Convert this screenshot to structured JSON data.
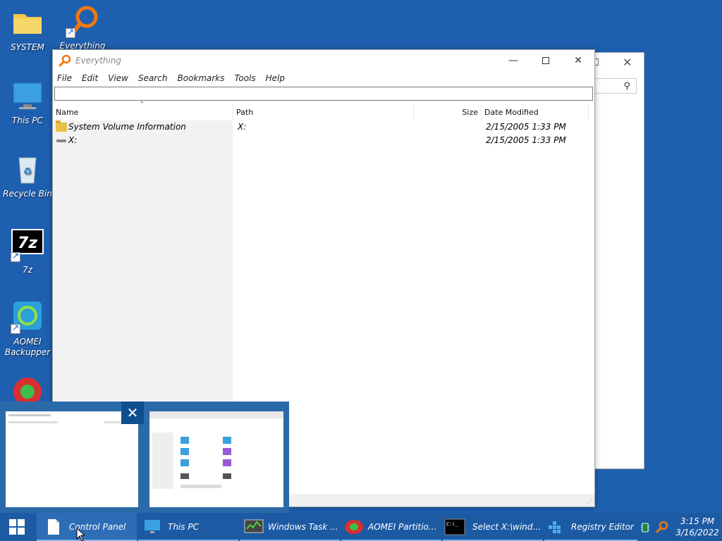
{
  "desktop": {
    "icons": [
      {
        "label": "SYSTEM"
      },
      {
        "label": "Everything"
      },
      {
        "label": "This PC"
      },
      {
        "label": "Recycle Bin"
      },
      {
        "label": "7z"
      },
      {
        "label": "AOMEI Backupper"
      }
    ]
  },
  "everything_window": {
    "title": "Everything",
    "menu": [
      "File",
      "Edit",
      "View",
      "Search",
      "Bookmarks",
      "Tools",
      "Help"
    ],
    "search_value": "",
    "columns": [
      "Name",
      "Path",
      "Size",
      "Date Modified"
    ],
    "rows": [
      {
        "name": "System Volume Information",
        "path": "X:",
        "size": "",
        "date": "2/15/2005 1:33 PM",
        "icon": "folder-icon"
      },
      {
        "name": "X:",
        "path": "",
        "size": "",
        "date": "2/15/2005 1:33 PM",
        "icon": "drive-icon"
      }
    ]
  },
  "taskbar": {
    "items": [
      {
        "label": "Control Panel",
        "icon": "document-icon"
      },
      {
        "label": "This PC",
        "icon": "monitor-icon"
      },
      {
        "label": "Windows Task ...",
        "icon": "task-manager-icon"
      },
      {
        "label": "AOMEI Partitio...",
        "icon": "aomei-partition-icon"
      },
      {
        "label": "Select X:\\wind...",
        "icon": "cmd-icon"
      },
      {
        "label": "Registry Editor",
        "icon": "registry-icon"
      }
    ],
    "clock_time": "3:15 PM",
    "clock_date": "3/16/2022"
  },
  "colors": {
    "desktop_bg": "#1f5fb0",
    "taskbar_bg": "#1c5aa4",
    "thumb_panel": "#2b6aa8"
  }
}
